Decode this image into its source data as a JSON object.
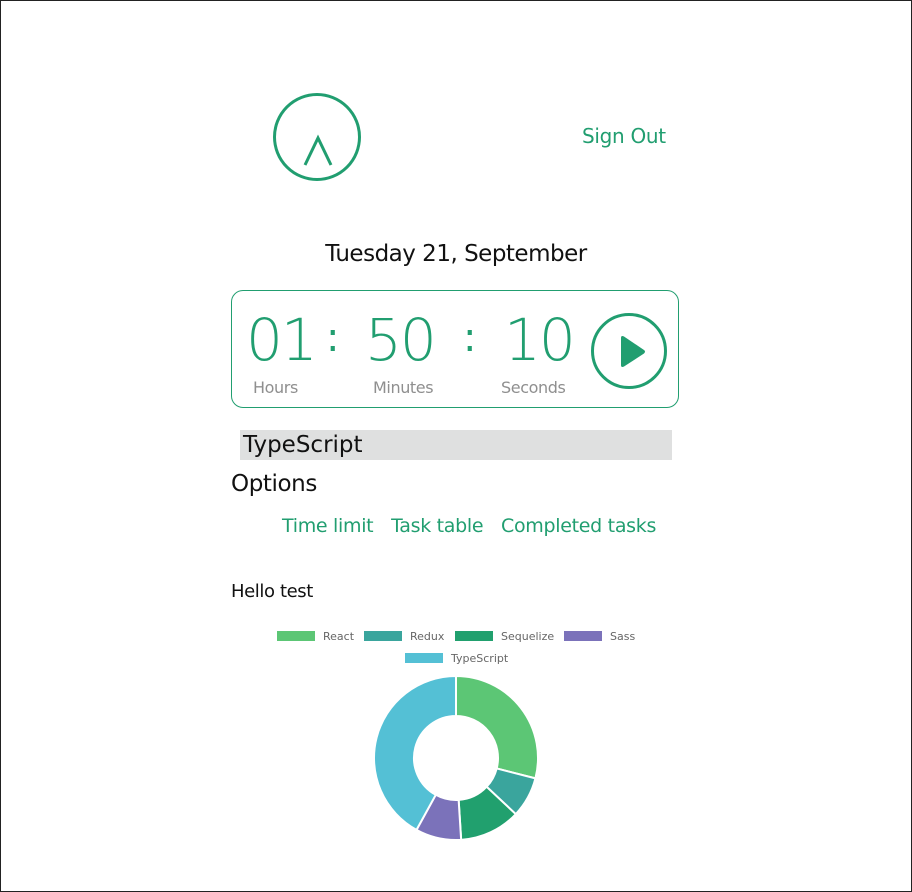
{
  "header": {
    "logo_icon": "chevron-up-icon",
    "sign_out_label": "Sign Out"
  },
  "date_label": "Tuesday 21, September",
  "timer": {
    "hours": "01",
    "minutes": "50",
    "seconds": "10",
    "hours_label": "Hours",
    "minutes_label": "Minutes",
    "seconds_label": "Seconds",
    "separator": ":",
    "play_icon": "play-icon"
  },
  "task_select": {
    "selected": "TypeScript"
  },
  "options": {
    "title": "Options",
    "links": [
      "Time limit",
      "Task table",
      "Completed tasks"
    ]
  },
  "greeting": "Hello test",
  "colors": {
    "accent": "#219e70",
    "select_bg": "#dfe0e0"
  },
  "chart_data": {
    "type": "pie",
    "subtype": "doughnut",
    "title": "",
    "categories": [
      "React",
      "Redux",
      "Sequelize",
      "Sass",
      "TypeScript"
    ],
    "values": [
      29,
      8,
      12,
      9,
      42
    ],
    "colors": [
      "#5cc675",
      "#3aa59d",
      "#21a06e",
      "#7b72ba",
      "#54c0d5"
    ],
    "legend": "top"
  }
}
